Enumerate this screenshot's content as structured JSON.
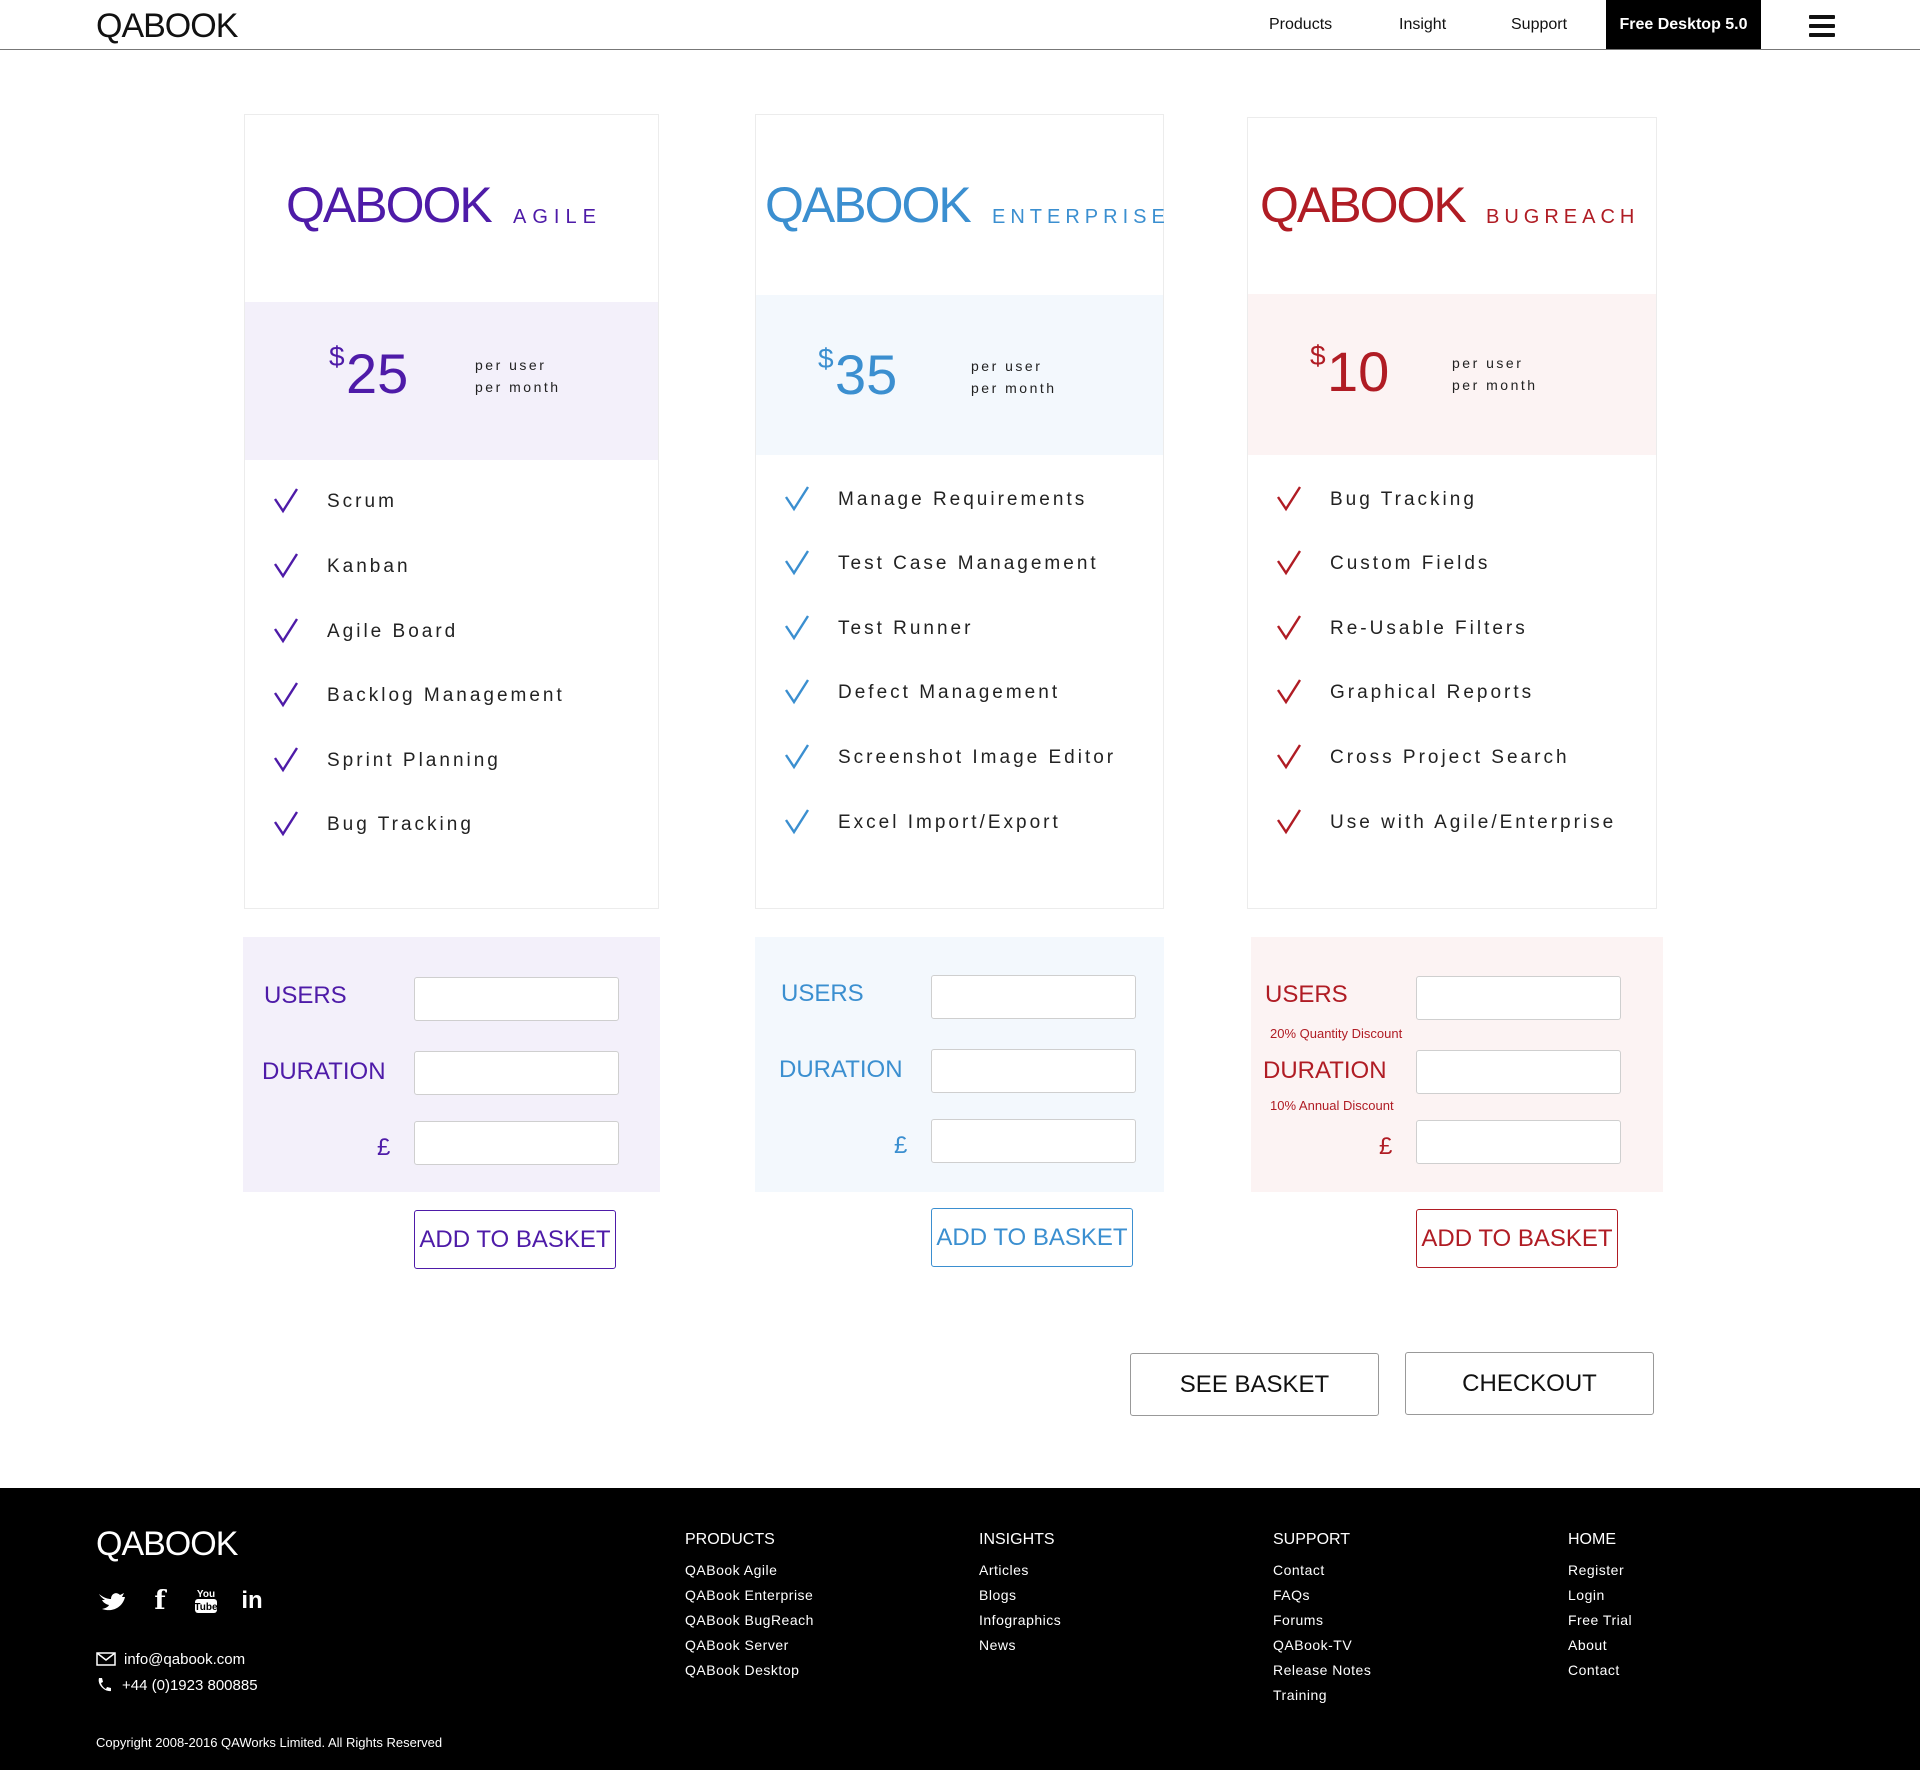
{
  "header": {
    "brand": "QABOOK",
    "nav": [
      "Products",
      "Insight",
      "Support"
    ],
    "cta": "Free Desktop 5.0"
  },
  "colors": {
    "agile": "#4e1ba8",
    "enterprise": "#3b8fd0",
    "bugreach": "#b01c24",
    "agile_bg": "#f3f0fa",
    "enterprise_bg": "#f3f8fd",
    "bugreach_bg": "#fcf3f3"
  },
  "plans": {
    "agile": {
      "logo": "QABOOK",
      "sub": "AGILE",
      "currency": "$",
      "price": "25",
      "per1": "per user",
      "per2": "per month",
      "features": [
        "Scrum",
        "Kanban",
        "Agile Board",
        "Backlog Management",
        "Sprint Planning",
        "Bug Tracking"
      ]
    },
    "enterprise": {
      "logo": "QABOOK",
      "sub": "ENTERPRISE",
      "currency": "$",
      "price": "35",
      "per1": "per user",
      "per2": "per month",
      "features": [
        "Manage Requirements",
        "Test Case Management",
        "Test Runner",
        "Defect Management",
        "Screenshot Image Editor",
        "Excel Import/Export"
      ]
    },
    "bugreach": {
      "logo": "QABOOK",
      "sub": "BUGREACH",
      "currency": "$",
      "price": "10",
      "per1": "per user",
      "per2": "per month",
      "features": [
        "Bug Tracking",
        "Custom Fields",
        "Re-Usable Filters",
        "Graphical Reports",
        "Cross Project Search",
        "Use with Agile/Enterprise"
      ]
    }
  },
  "order": {
    "users_label": "USERS",
    "duration_label": "DURATION",
    "currency_label": "£",
    "add_label": "ADD TO BASKET",
    "users_discount": "20% Quantity Discount",
    "duration_discount": "10% Annual Discount"
  },
  "actions": {
    "see_basket": "SEE BASKET",
    "checkout": "CHECKOUT"
  },
  "footer": {
    "brand": "QABOOK",
    "social": [
      "twitter-icon",
      "facebook-icon",
      "youtube-icon",
      "linkedin-icon"
    ],
    "email": "info@qabook.com",
    "phone": "+44 (0)1923 800885",
    "columns": [
      {
        "head": "PRODUCTS",
        "links": [
          "QABook Agile",
          "QABook Enterprise",
          "QABook BugReach",
          "QABook Server",
          "QABook Desktop"
        ]
      },
      {
        "head": "INSIGHTS",
        "links": [
          "Articles",
          "Blogs",
          "Infographics",
          "News"
        ]
      },
      {
        "head": "SUPPORT",
        "links": [
          "Contact",
          "FAQs",
          "Forums",
          "QABook-TV",
          "Release Notes",
          "Training"
        ]
      },
      {
        "head": "HOME",
        "links": [
          "Register",
          "Login",
          "Free Trial",
          "About",
          "Contact"
        ]
      }
    ],
    "copyright": "Copyright 2008-2016 QAWorks Limited. All Rights Reserved"
  }
}
